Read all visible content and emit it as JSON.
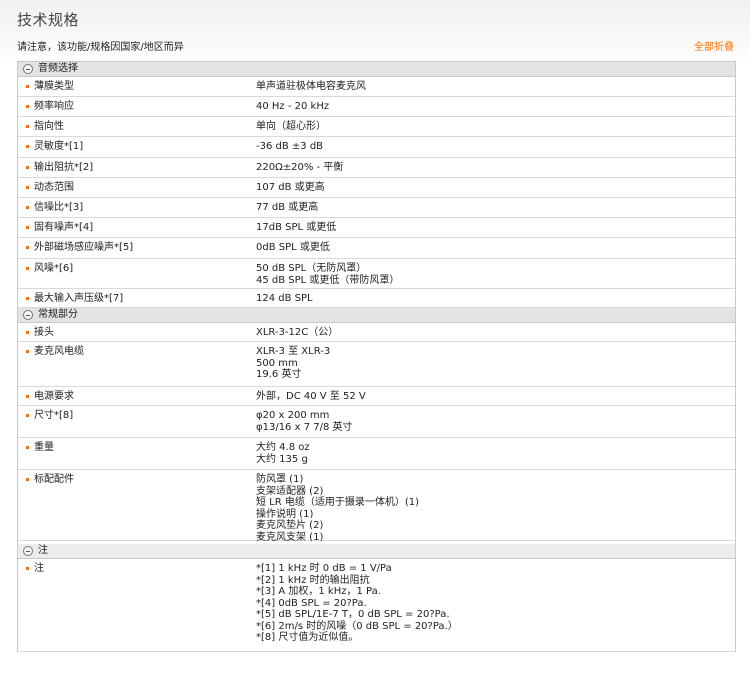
{
  "page": {
    "title": "技术规格",
    "notice": "请注意，该功能/规格因国家/地区而异",
    "collapse_all": "全部折叠"
  },
  "sections": [
    {
      "title": "音频选择",
      "rows": [
        {
          "label": "薄膜类型",
          "value": [
            "单声道驻极体电容麦克风"
          ]
        },
        {
          "label": "频率响应",
          "value": [
            "40 Hz - 20 kHz"
          ]
        },
        {
          "label": "指向性",
          "value": [
            "单向（超心形）"
          ]
        },
        {
          "label": "灵敏度*[1]",
          "value": [
            "-36 dB ±3 dB"
          ]
        },
        {
          "label": "输出阻抗*[2]",
          "value": [
            "220Ω±20% - 平衡"
          ]
        },
        {
          "label": "动态范围",
          "value": [
            "107 dB 或更高"
          ]
        },
        {
          "label": "信噪比*[3]",
          "value": [
            "77 dB 或更高"
          ]
        },
        {
          "label": "固有噪声*[4]",
          "value": [
            "17dB SPL 或更低"
          ]
        },
        {
          "label": "外部磁场感应噪声*[5]",
          "value": [
            "0dB SPL 或更低"
          ]
        },
        {
          "label": "风噪*[6]",
          "value": [
            "50 dB SPL（无防风罩）",
            "45 dB SPL 或更低（带防风罩）"
          ]
        },
        {
          "label": "最大输入声压级*[7]",
          "value": [
            "124 dB SPL"
          ]
        }
      ]
    },
    {
      "title": "常规部分",
      "rows": [
        {
          "label": "接头",
          "value": [
            "XLR-3-12C（公）"
          ]
        },
        {
          "label": "麦克风电缆",
          "value": [
            "XLR-3 至 XLR-3",
            "500 mm",
            "19.6 英寸"
          ]
        },
        {
          "label": "电源要求",
          "value": [
            "外部，DC 40 V 至 52 V"
          ]
        },
        {
          "label": "尺寸*[8]",
          "value": [
            "φ20 x 200 mm",
            "φ13/16 x 7 7/8 英寸"
          ]
        },
        {
          "label": "重量",
          "value": [
            "大约 4.8 oz",
            "大约 135 g"
          ]
        },
        {
          "label": "标配配件",
          "value": [
            "防风罩 (1)",
            "支架适配器 (2)",
            "短 LR 电缆（适用于摄录一体机）(1)",
            "操作说明 (1)",
            "麦克风垫片 (2)",
            "麦克风支架 (1)"
          ]
        }
      ]
    },
    {
      "title": "注",
      "rows": [
        {
          "label": "注",
          "value": [
            "*[1] 1 kHz 时 0 dB = 1 V/Pa",
            "*[2] 1 kHz 时的输出阻抗",
            "*[3] A 加权，1 kHz，1 Pa.",
            "*[4] 0dB SPL = 20?Pa.",
            "*[5] dB SPL/1E-7 T，0 dB SPL = 20?Pa.",
            "*[6] 2m/s 时的风噪（0 dB SPL = 20?Pa.）",
            "*[8] 尺寸值为近似值。"
          ]
        }
      ]
    }
  ]
}
